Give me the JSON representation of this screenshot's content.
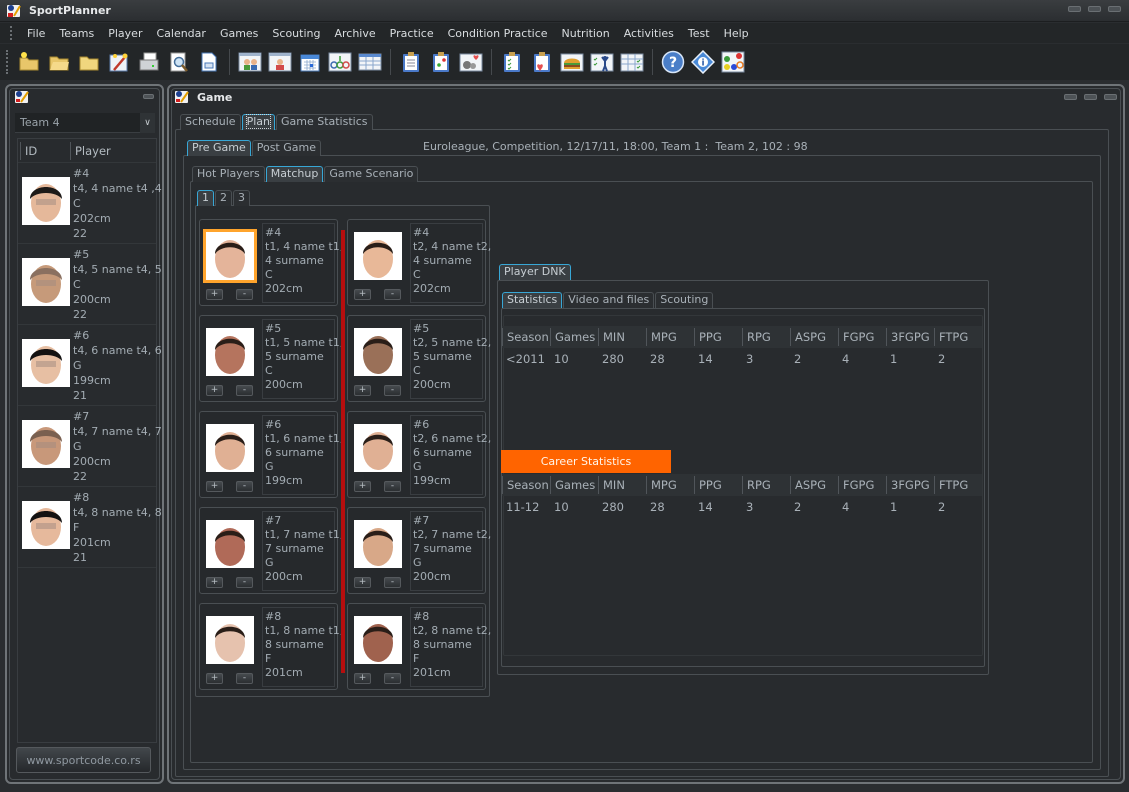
{
  "app": {
    "title": "SportPlanner",
    "icon": "sportplanner-logo-icon"
  },
  "menu": [
    "File",
    "Teams",
    "Player",
    "Calendar",
    "Games",
    "Scouting",
    "Archive",
    "Practice",
    "Condition Practice",
    "Nutrition",
    "Activities",
    "Test",
    "Help"
  ],
  "toolbar": {
    "groups": [
      [
        "new-folder-icon",
        "open-folder-icon",
        "folder-icon",
        "wizard-icon",
        "print-icon",
        "print-preview-icon",
        "export-icon"
      ],
      [
        "teams-grid-icon",
        "player-grid-icon",
        "calendar-icon",
        "diagram-icon",
        "table-icon"
      ],
      [
        "clipboard-icon",
        "clipboard-plan-icon",
        "condition-heart-icon"
      ],
      [
        "checklist-icon",
        "checklist-heart-icon",
        "nutrition-burger-icon",
        "activities-icon",
        "test-grid-icon"
      ],
      [
        "help-icon",
        "info-icon",
        "tactics-board-icon"
      ]
    ]
  },
  "left_panel": {
    "team_select": "Team 4",
    "columns": [
      "ID",
      "Player"
    ],
    "players": [
      {
        "number": "#4",
        "name": "t4, 4 name t4 ,4",
        "position": "C",
        "height": "202cm",
        "age": "22"
      },
      {
        "number": "#5",
        "name": "t4, 5 name t4, 5",
        "position": "C",
        "height": "200cm",
        "age": "22"
      },
      {
        "number": "#6",
        "name": "t4, 6 name t4, 6",
        "position": "G",
        "height": "199cm",
        "age": "21"
      },
      {
        "number": "#7",
        "name": "t4, 7 name t4, 7",
        "position": "G",
        "height": "200cm",
        "age": "22"
      },
      {
        "number": "#8",
        "name": "t4, 8 name t4, 8",
        "position": "F",
        "height": "201cm",
        "age": "21"
      }
    ],
    "website_button": "www.sportcode.co.rs"
  },
  "game_panel": {
    "title": "Game",
    "main_tabs": [
      "Schedule",
      "Plan",
      "Game Statistics"
    ],
    "main_tab_active": "Plan",
    "phase_tabs": [
      "Pre Game",
      "Post Game"
    ],
    "phase_tab_active": "Pre Game",
    "game_info": "Euroleague, Competition, 12/17/11, 18:00, Team 1 :  Team 2, 102 : 98",
    "sub_tabs": [
      "Hot Players",
      "Matchup",
      "Game Scenario"
    ],
    "sub_tab_active": "Matchup",
    "page_tabs": [
      "1",
      "2",
      "3"
    ],
    "page_tab_active": "1",
    "plus_label": "+",
    "minus_label": "-",
    "team1": [
      {
        "number": "#4",
        "name1": "t1, 4 name t1,",
        "name2": "4 surname",
        "position": "C",
        "height": "202cm",
        "selected": true
      },
      {
        "number": "#5",
        "name1": "t1, 5 name t1,",
        "name2": "5 surname",
        "position": "C",
        "height": "200cm"
      },
      {
        "number": "#6",
        "name1": "t1, 6 name t1,",
        "name2": "6 surname",
        "position": "G",
        "height": "199cm"
      },
      {
        "number": "#7",
        "name1": "t1, 7 name t1,",
        "name2": "7 surname",
        "position": "G",
        "height": "200cm"
      },
      {
        "number": "#8",
        "name1": "t1, 8 name t1,",
        "name2": "8 surname",
        "position": "F",
        "height": "201cm"
      }
    ],
    "team2": [
      {
        "number": "#4",
        "name1": "t2, 4 name t2,",
        "name2": "4 surname",
        "position": "C",
        "height": "202cm"
      },
      {
        "number": "#5",
        "name1": "t2, 5 name t2,",
        "name2": "5 surname",
        "position": "C",
        "height": "200cm"
      },
      {
        "number": "#6",
        "name1": "t2, 6 name t2,",
        "name2": "6 surname",
        "position": "G",
        "height": "199cm"
      },
      {
        "number": "#7",
        "name1": "t2, 7 name t2,",
        "name2": "7 surname",
        "position": "G",
        "height": "200cm"
      },
      {
        "number": "#8",
        "name1": "t2, 8 name t2,",
        "name2": "8 surname",
        "position": "F",
        "height": "201cm"
      }
    ],
    "player_panel": {
      "tab": "Player DNK",
      "tabs": [
        "Statistics",
        "Video and files",
        "Scouting"
      ],
      "tab_active": "Statistics",
      "columns": [
        "Season",
        "Games",
        "MIN",
        "MPG",
        "PPG",
        "RPG",
        "ASPG",
        "FGPG",
        "3FGPG",
        "FTPG"
      ],
      "season_rows": [
        [
          "<2011",
          "10",
          "280",
          "28",
          "14",
          "3",
          "2",
          "4",
          "1",
          "2"
        ]
      ],
      "career_label": "Career Statistics",
      "career_rows": [
        [
          "11-12",
          "10",
          "280",
          "28",
          "14",
          "3",
          "2",
          "4",
          "1",
          "2"
        ]
      ]
    }
  },
  "colors": {
    "accent_tab": "#38a7d6",
    "career_banner": "#ff6400",
    "selected_player_border": "#ffa42c",
    "divider_red": "#b60e0e"
  }
}
